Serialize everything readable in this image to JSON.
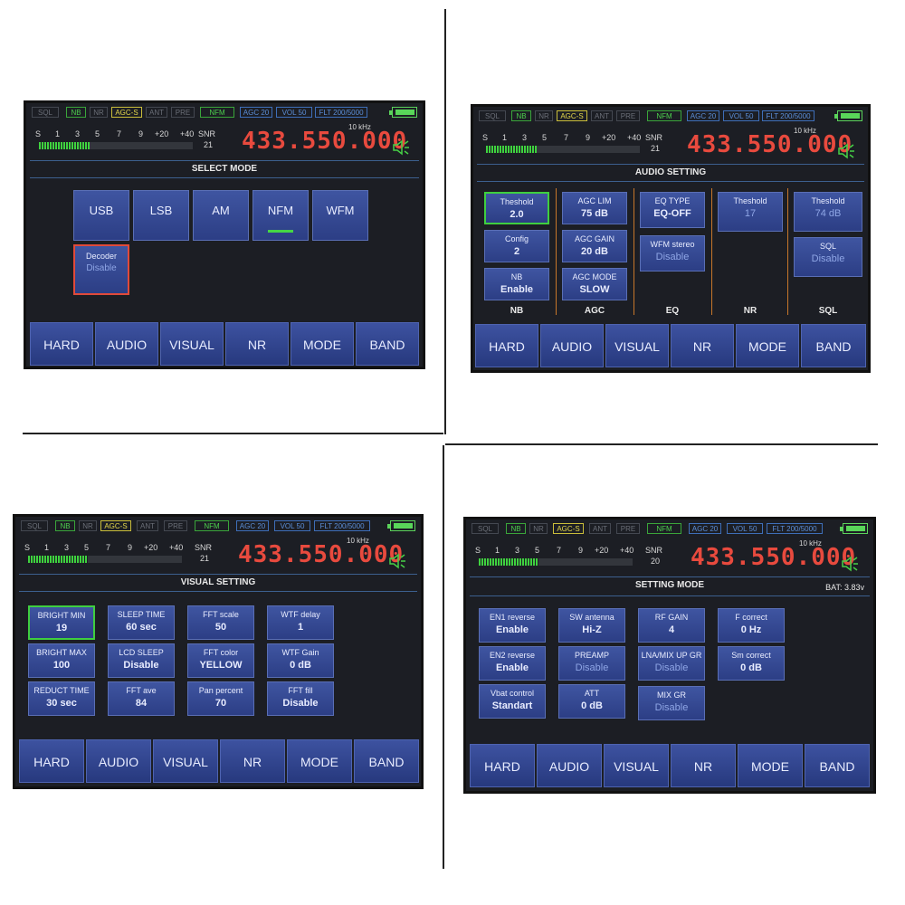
{
  "status_bar": {
    "chips": [
      "SQL",
      "NB",
      "NR",
      "AGC-S",
      "ANT",
      "PRE",
      "NFM",
      "AGC 20",
      "VOL 50"
    ],
    "flt": [
      "FLT 200/5000",
      "FLT 200/5000",
      "FLT 200/5000",
      "FLT 200/5000"
    ]
  },
  "meter": {
    "scale": [
      "S",
      "1",
      "3",
      "5",
      "7",
      "9",
      "+20",
      "+40"
    ],
    "snr_label": "SNR",
    "step": "10 kHz",
    "snr_values": [
      "21",
      "21",
      "21",
      "20"
    ]
  },
  "frequency": "433.550.000",
  "nav": [
    "HARD",
    "AUDIO",
    "VISUAL",
    "NR",
    "MODE",
    "BAND"
  ],
  "panels": {
    "select_mode": {
      "title": "SELECT MODE",
      "modes": [
        "USB",
        "LSB",
        "AM",
        "NFM",
        "WFM"
      ],
      "active_mode": "NFM",
      "decoder": {
        "label": "Decoder",
        "value": "Disable"
      }
    },
    "audio": {
      "title": "AUDIO SETTING",
      "nb": [
        {
          "label": "Theshold",
          "value": "2.0"
        },
        {
          "label": "Config",
          "value": "2"
        },
        {
          "label": "NB",
          "value": "Enable"
        }
      ],
      "agc": [
        {
          "label": "AGC LIM",
          "value": "75 dB"
        },
        {
          "label": "AGC GAIN",
          "value": "20 dB"
        },
        {
          "label": "AGC MODE",
          "value": "SLOW"
        }
      ],
      "eq": [
        {
          "label": "EQ TYPE",
          "value": "EQ-OFF"
        },
        {
          "label": "WFM stereo",
          "value": "Disable"
        }
      ],
      "nr": [
        {
          "label": "Theshold",
          "value": "17"
        }
      ],
      "sql": [
        {
          "label": "Theshold",
          "value": "74 dB"
        },
        {
          "label": "SQL",
          "value": "Disable"
        }
      ],
      "groups": [
        "NB",
        "AGC",
        "EQ",
        "NR",
        "SQL"
      ]
    },
    "visual": {
      "title": "VISUAL SETTING",
      "items": [
        {
          "label": "BRIGHT MIN",
          "value": "19"
        },
        {
          "label": "SLEEP TIME",
          "value": "60 sec"
        },
        {
          "label": "FFT scale",
          "value": "50"
        },
        {
          "label": "WTF delay",
          "value": "1"
        },
        {
          "label": "BRIGHT MAX",
          "value": "100"
        },
        {
          "label": "LCD SLEEP",
          "value": "Disable"
        },
        {
          "label": "FFT color",
          "value": "YELLOW"
        },
        {
          "label": "WTF Gain",
          "value": "0 dB"
        },
        {
          "label": "REDUCT TIME",
          "value": "30 sec"
        },
        {
          "label": "FFT ave",
          "value": "84"
        },
        {
          "label": "Pan percent",
          "value": "70"
        },
        {
          "label": "FFT fill",
          "value": "Disable"
        }
      ]
    },
    "setting": {
      "title": "SETTING MODE",
      "battery": "BAT: 3.83v",
      "items": [
        {
          "label": "EN1 reverse",
          "value": "Enable"
        },
        {
          "label": "SW antenna",
          "value": "Hi-Z"
        },
        {
          "label": "RF GAIN",
          "value": "4"
        },
        {
          "label": "F correct",
          "value": "0 Hz"
        },
        {
          "label": "EN2 reverse",
          "value": "Enable"
        },
        {
          "label": "PREAMP",
          "value": "Disable"
        },
        {
          "label": "LNA/MIX UP GR",
          "value": "Disable"
        },
        {
          "label": "Sm correct",
          "value": "0 dB"
        },
        {
          "label": "Vbat control",
          "value": "Standart"
        },
        {
          "label": "ATT",
          "value": "0 dB"
        },
        {
          "label": "MIX GR",
          "value": "Disable"
        }
      ]
    }
  }
}
